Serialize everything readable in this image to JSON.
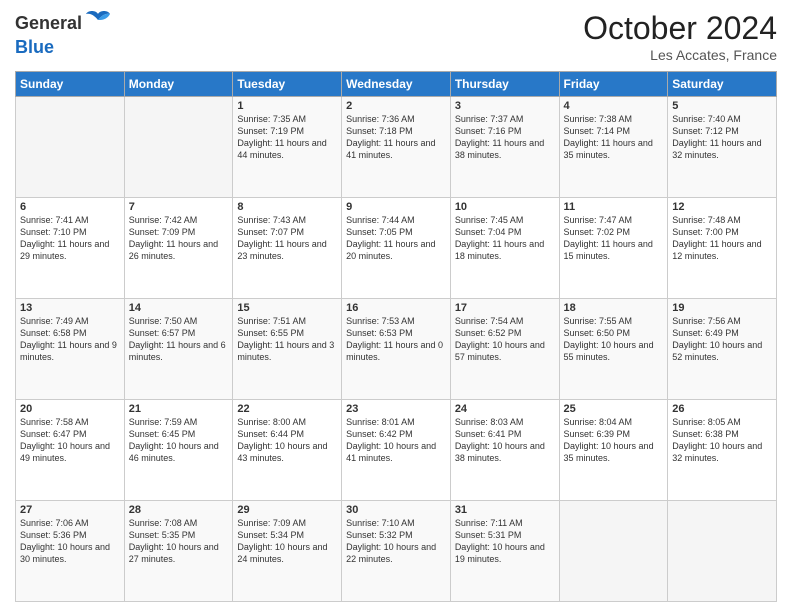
{
  "header": {
    "logo_general": "General",
    "logo_blue": "Blue",
    "month": "October 2024",
    "location": "Les Accates, France"
  },
  "days_of_week": [
    "Sunday",
    "Monday",
    "Tuesday",
    "Wednesday",
    "Thursday",
    "Friday",
    "Saturday"
  ],
  "weeks": [
    [
      {
        "day": "",
        "content": ""
      },
      {
        "day": "",
        "content": ""
      },
      {
        "day": "1",
        "content": "Sunrise: 7:35 AM\nSunset: 7:19 PM\nDaylight: 11 hours and 44 minutes."
      },
      {
        "day": "2",
        "content": "Sunrise: 7:36 AM\nSunset: 7:18 PM\nDaylight: 11 hours and 41 minutes."
      },
      {
        "day": "3",
        "content": "Sunrise: 7:37 AM\nSunset: 7:16 PM\nDaylight: 11 hours and 38 minutes."
      },
      {
        "day": "4",
        "content": "Sunrise: 7:38 AM\nSunset: 7:14 PM\nDaylight: 11 hours and 35 minutes."
      },
      {
        "day": "5",
        "content": "Sunrise: 7:40 AM\nSunset: 7:12 PM\nDaylight: 11 hours and 32 minutes."
      }
    ],
    [
      {
        "day": "6",
        "content": "Sunrise: 7:41 AM\nSunset: 7:10 PM\nDaylight: 11 hours and 29 minutes."
      },
      {
        "day": "7",
        "content": "Sunrise: 7:42 AM\nSunset: 7:09 PM\nDaylight: 11 hours and 26 minutes."
      },
      {
        "day": "8",
        "content": "Sunrise: 7:43 AM\nSunset: 7:07 PM\nDaylight: 11 hours and 23 minutes."
      },
      {
        "day": "9",
        "content": "Sunrise: 7:44 AM\nSunset: 7:05 PM\nDaylight: 11 hours and 20 minutes."
      },
      {
        "day": "10",
        "content": "Sunrise: 7:45 AM\nSunset: 7:04 PM\nDaylight: 11 hours and 18 minutes."
      },
      {
        "day": "11",
        "content": "Sunrise: 7:47 AM\nSunset: 7:02 PM\nDaylight: 11 hours and 15 minutes."
      },
      {
        "day": "12",
        "content": "Sunrise: 7:48 AM\nSunset: 7:00 PM\nDaylight: 11 hours and 12 minutes."
      }
    ],
    [
      {
        "day": "13",
        "content": "Sunrise: 7:49 AM\nSunset: 6:58 PM\nDaylight: 11 hours and 9 minutes."
      },
      {
        "day": "14",
        "content": "Sunrise: 7:50 AM\nSunset: 6:57 PM\nDaylight: 11 hours and 6 minutes."
      },
      {
        "day": "15",
        "content": "Sunrise: 7:51 AM\nSunset: 6:55 PM\nDaylight: 11 hours and 3 minutes."
      },
      {
        "day": "16",
        "content": "Sunrise: 7:53 AM\nSunset: 6:53 PM\nDaylight: 11 hours and 0 minutes."
      },
      {
        "day": "17",
        "content": "Sunrise: 7:54 AM\nSunset: 6:52 PM\nDaylight: 10 hours and 57 minutes."
      },
      {
        "day": "18",
        "content": "Sunrise: 7:55 AM\nSunset: 6:50 PM\nDaylight: 10 hours and 55 minutes."
      },
      {
        "day": "19",
        "content": "Sunrise: 7:56 AM\nSunset: 6:49 PM\nDaylight: 10 hours and 52 minutes."
      }
    ],
    [
      {
        "day": "20",
        "content": "Sunrise: 7:58 AM\nSunset: 6:47 PM\nDaylight: 10 hours and 49 minutes."
      },
      {
        "day": "21",
        "content": "Sunrise: 7:59 AM\nSunset: 6:45 PM\nDaylight: 10 hours and 46 minutes."
      },
      {
        "day": "22",
        "content": "Sunrise: 8:00 AM\nSunset: 6:44 PM\nDaylight: 10 hours and 43 minutes."
      },
      {
        "day": "23",
        "content": "Sunrise: 8:01 AM\nSunset: 6:42 PM\nDaylight: 10 hours and 41 minutes."
      },
      {
        "day": "24",
        "content": "Sunrise: 8:03 AM\nSunset: 6:41 PM\nDaylight: 10 hours and 38 minutes."
      },
      {
        "day": "25",
        "content": "Sunrise: 8:04 AM\nSunset: 6:39 PM\nDaylight: 10 hours and 35 minutes."
      },
      {
        "day": "26",
        "content": "Sunrise: 8:05 AM\nSunset: 6:38 PM\nDaylight: 10 hours and 32 minutes."
      }
    ],
    [
      {
        "day": "27",
        "content": "Sunrise: 7:06 AM\nSunset: 5:36 PM\nDaylight: 10 hours and 30 minutes."
      },
      {
        "day": "28",
        "content": "Sunrise: 7:08 AM\nSunset: 5:35 PM\nDaylight: 10 hours and 27 minutes."
      },
      {
        "day": "29",
        "content": "Sunrise: 7:09 AM\nSunset: 5:34 PM\nDaylight: 10 hours and 24 minutes."
      },
      {
        "day": "30",
        "content": "Sunrise: 7:10 AM\nSunset: 5:32 PM\nDaylight: 10 hours and 22 minutes."
      },
      {
        "day": "31",
        "content": "Sunrise: 7:11 AM\nSunset: 5:31 PM\nDaylight: 10 hours and 19 minutes."
      },
      {
        "day": "",
        "content": ""
      },
      {
        "day": "",
        "content": ""
      }
    ]
  ]
}
